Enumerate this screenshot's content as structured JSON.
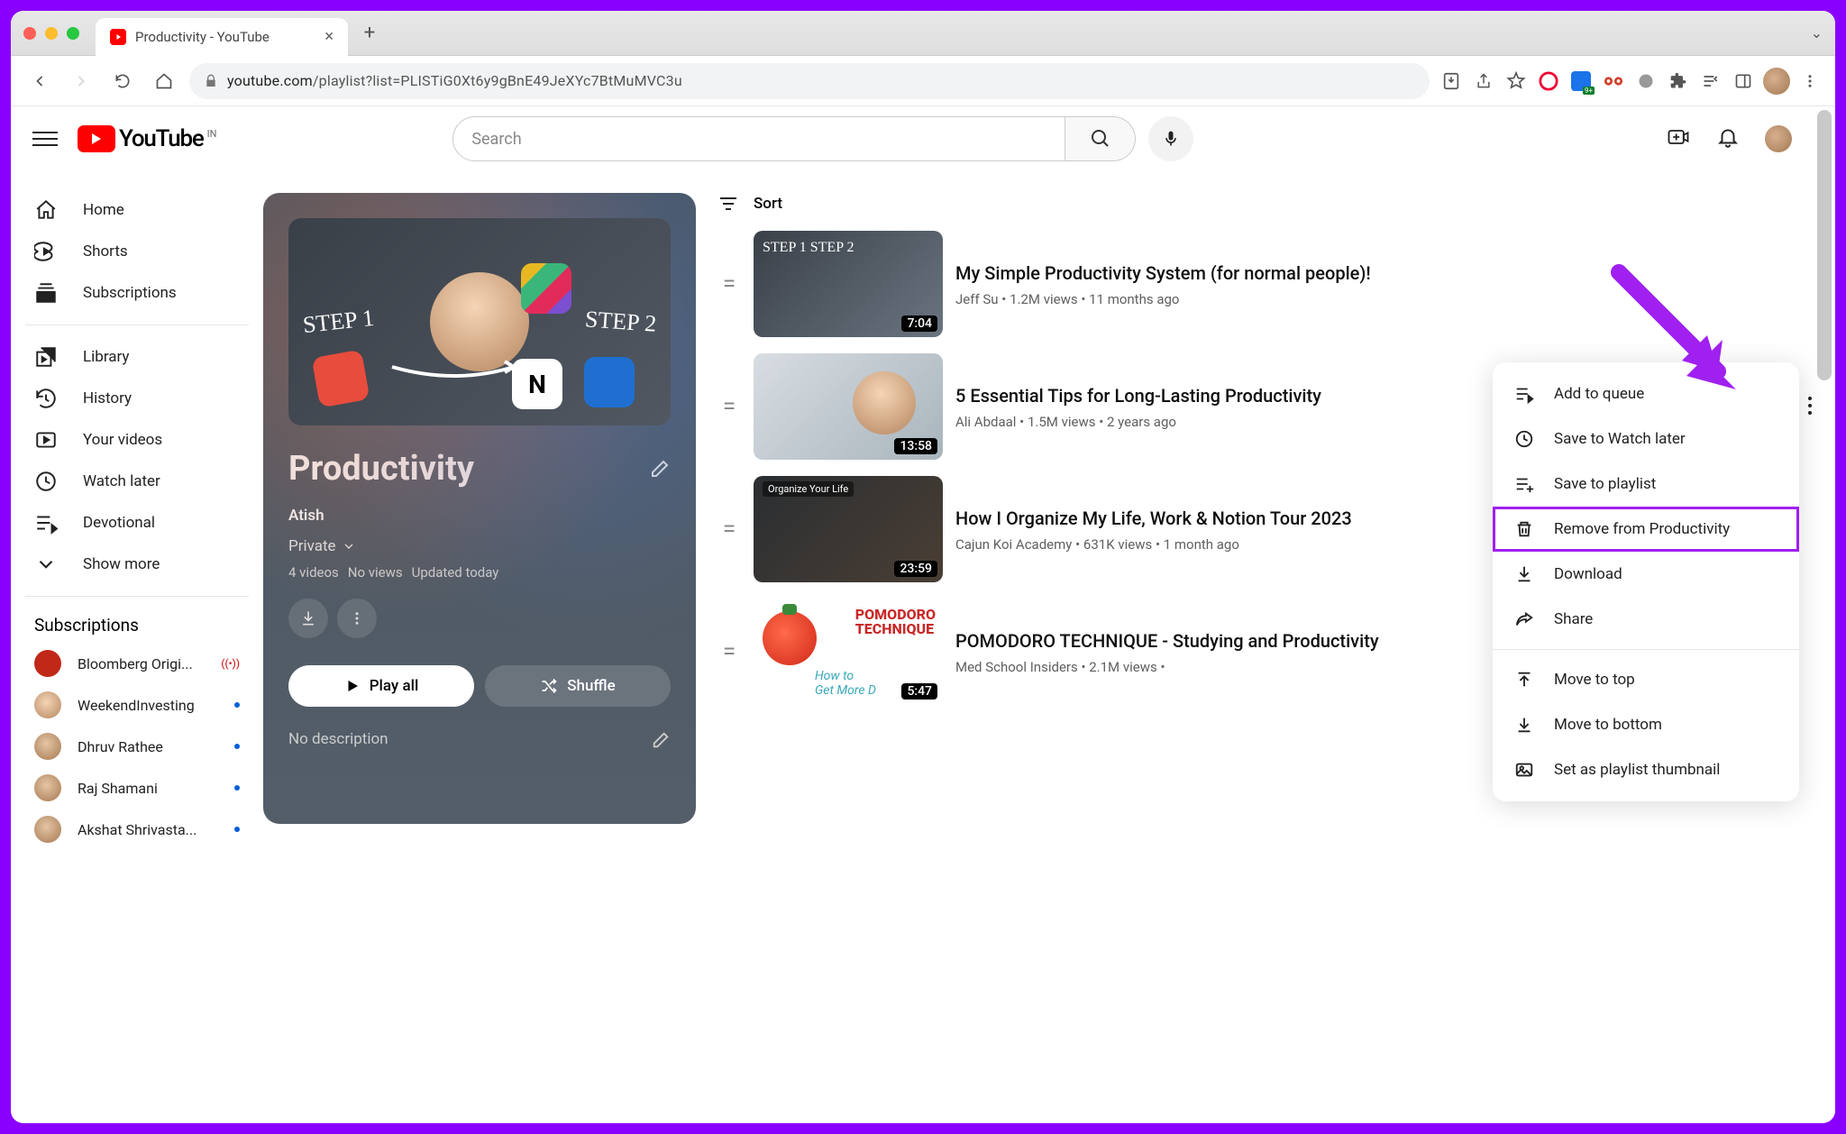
{
  "browser": {
    "tab_title": "Productivity - YouTube",
    "url_host": "youtube.com",
    "url_path": "/playlist?list=PLISTiG0Xt6y9gBnE49JeXYc7BtMuMVC3u"
  },
  "masthead": {
    "brand": "YouTube",
    "region": "IN",
    "search_placeholder": "Search"
  },
  "sidebar": {
    "main": [
      {
        "label": "Home"
      },
      {
        "label": "Shorts"
      },
      {
        "label": "Subscriptions"
      }
    ],
    "library": [
      {
        "label": "Library"
      },
      {
        "label": "History"
      },
      {
        "label": "Your videos"
      },
      {
        "label": "Watch later"
      },
      {
        "label": "Devotional"
      },
      {
        "label": "Show more"
      }
    ],
    "subs_header": "Subscriptions",
    "subs": [
      {
        "label": "Bloomberg Origi...",
        "live": true
      },
      {
        "label": "WeekendInvesting",
        "dot": true
      },
      {
        "label": "Dhruv Rathee",
        "dot": true
      },
      {
        "label": "Raj Shamani",
        "dot": true
      },
      {
        "label": "Akshat Shrivasta...",
        "dot": true
      }
    ]
  },
  "playlist": {
    "title": "Productivity",
    "owner": "Atish",
    "visibility": "Private",
    "meta": [
      "4 videos",
      "No views",
      "Updated today"
    ],
    "play_all": "Play all",
    "shuffle": "Shuffle",
    "description": "No description"
  },
  "sort_label": "Sort",
  "videos": [
    {
      "title": "My Simple Productivity System (for normal people)!",
      "channel": "Jeff Su",
      "views": "1.2M views",
      "age": "11 months ago",
      "duration": "7:04"
    },
    {
      "title": "5 Essential Tips for Long-Lasting Productivity",
      "channel": "Ali Abdaal",
      "views": "1.5M views",
      "age": "2 years ago",
      "duration": "13:58"
    },
    {
      "title": "How I Organize My Life, Work & Notion Tour 2023",
      "channel": "Cajun Koi Academy",
      "views": "631K views",
      "age": "1 month ago",
      "duration": "23:59"
    },
    {
      "title": "POMODORO TECHNIQUE - Studying and Productivity",
      "channel": "Med School Insiders",
      "views": "2.1M views",
      "age": "",
      "duration": "5:47"
    }
  ],
  "menu": {
    "items": [
      {
        "label": "Add to queue",
        "icon": "queue"
      },
      {
        "label": "Save to Watch later",
        "icon": "clock"
      },
      {
        "label": "Save to playlist",
        "icon": "playlist-add"
      },
      {
        "label": "Remove from Productivity",
        "icon": "trash",
        "hl": true
      },
      {
        "label": "Download",
        "icon": "download"
      },
      {
        "label": "Share",
        "icon": "share"
      }
    ],
    "items2": [
      {
        "label": "Move to top",
        "icon": "arrow-top"
      },
      {
        "label": "Move to bottom",
        "icon": "arrow-bottom"
      },
      {
        "label": "Set as playlist thumbnail",
        "icon": "image"
      }
    ]
  },
  "thumb_text": {
    "pomo_line1": "POMODORO",
    "pomo_line2": "TECHNIQUE",
    "pomo_sub1": "How to",
    "pomo_sub2": "Get More D"
  }
}
